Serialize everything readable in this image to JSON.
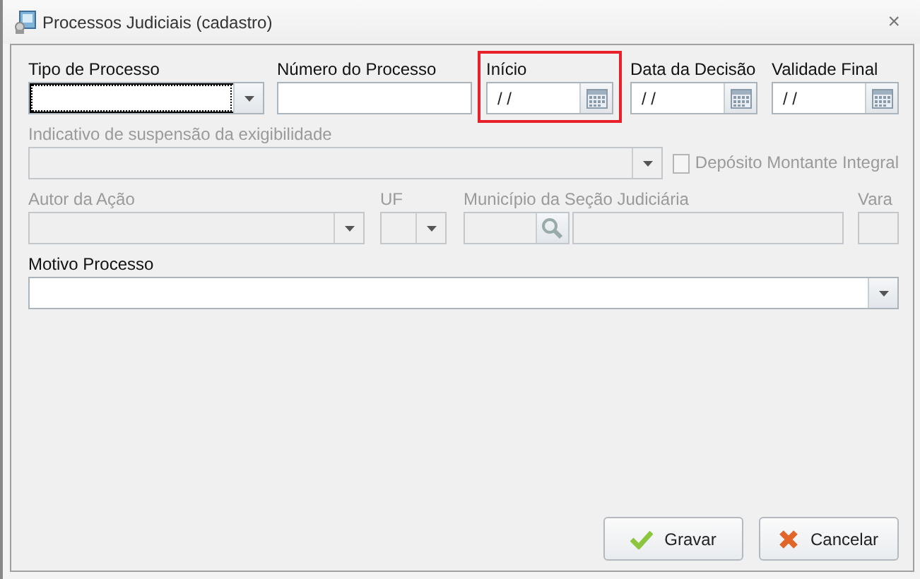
{
  "window": {
    "title": "Processos Judiciais (cadastro)",
    "close": "×"
  },
  "rows": [
    [
      {
        "kind": "combo",
        "label": "Tipo de Processo",
        "disabled": false,
        "focused": true
      },
      {
        "kind": "text",
        "label": "Número do Processo",
        "disabled": false
      },
      {
        "kind": "date",
        "label": "Início",
        "value": "/ /",
        "disabled": false,
        "highlighted": true
      },
      {
        "kind": "date",
        "label": "Data da Decisão",
        "value": "/ /",
        "disabled": false
      },
      {
        "kind": "date",
        "label": "Validade Final",
        "value": "/ /",
        "disabled": false
      }
    ],
    [
      {
        "kind": "combo",
        "label": "Indicativo de suspensão da exigibilidade",
        "disabled": true
      },
      {
        "kind": "checkbox",
        "label": "Depósito Montante Integral",
        "checked": false,
        "disabled": true
      }
    ],
    [
      {
        "kind": "combo",
        "label": "Autor da Ação",
        "disabled": true
      },
      {
        "kind": "combo",
        "label": "UF",
        "disabled": true
      },
      {
        "kind": "lookup",
        "label": "Município da Seção Judiciária",
        "disabled": true
      },
      {
        "kind": "text",
        "label": "Vara",
        "disabled": true
      }
    ],
    [
      {
        "kind": "combo",
        "label": "Motivo Processo",
        "disabled": false
      }
    ]
  ],
  "buttons": [
    {
      "kind": "save",
      "label": "Gravar"
    },
    {
      "kind": "cancel",
      "label": "Cancelar"
    }
  ]
}
